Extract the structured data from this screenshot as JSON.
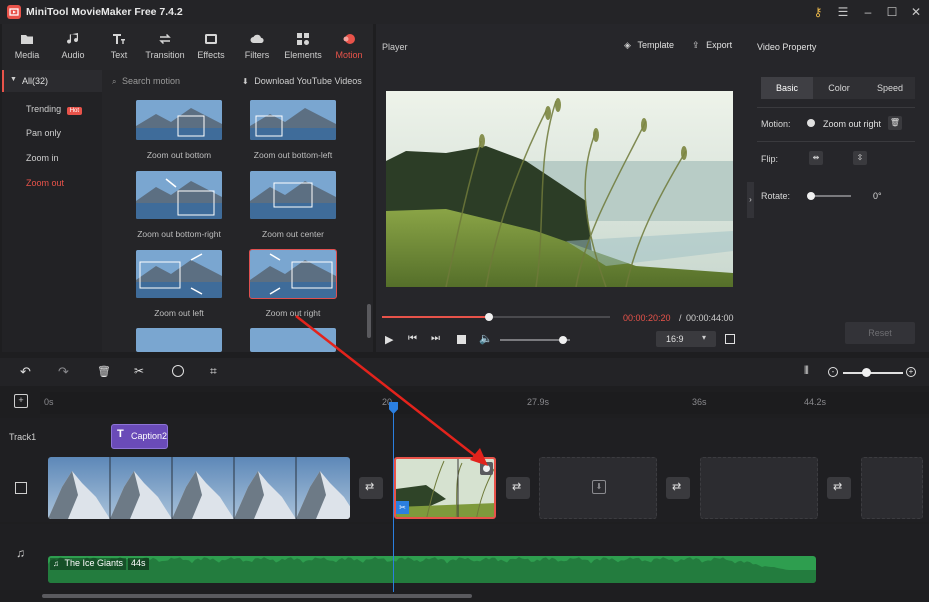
{
  "app": {
    "title": "MiniTool MovieMaker Free 7.4.2"
  },
  "toolbar": {
    "items": [
      {
        "label": "Media",
        "icon": "folder-icon"
      },
      {
        "label": "Audio",
        "icon": "music-note-icon"
      },
      {
        "label": "Text",
        "icon": "text-icon"
      },
      {
        "label": "Transition",
        "icon": "transition-icon"
      },
      {
        "label": "Effects",
        "icon": "effects-icon"
      },
      {
        "label": "Filters",
        "icon": "filters-icon"
      },
      {
        "label": "Elements",
        "icon": "elements-icon"
      },
      {
        "label": "Motion",
        "icon": "motion-icon"
      }
    ],
    "active": "Motion",
    "accent": "#e8534a"
  },
  "categories": {
    "all_label": "All(32)",
    "items": [
      {
        "label": "Trending",
        "badge": "Hot"
      },
      {
        "label": "Pan only"
      },
      {
        "label": "Zoom in"
      },
      {
        "label": "Zoom out",
        "active": true
      }
    ]
  },
  "motion": {
    "search_placeholder": "Search motion",
    "download_label": "Download YouTube Videos",
    "effects": [
      {
        "label": "Zoom out bottom"
      },
      {
        "label": "Zoom out bottom-left"
      },
      {
        "label": "Zoom out bottom-right"
      },
      {
        "label": "Zoom out center"
      },
      {
        "label": "Zoom out left"
      },
      {
        "label": "Zoom out right",
        "selected": true
      }
    ]
  },
  "player": {
    "title": "Player",
    "template_label": "Template",
    "export_label": "Export",
    "current_time": "00:00:20:20",
    "separator": "/",
    "total_time": "00:00:44:00",
    "progress": 0.47,
    "volume": 0.9,
    "aspect": "16:9"
  },
  "property": {
    "title": "Video Property",
    "tabs": [
      "Basic",
      "Color",
      "Speed"
    ],
    "active_tab": "Basic",
    "motion_label": "Motion:",
    "motion_value": "Zoom out right",
    "flip_label": "Flip:",
    "rotate_label": "Rotate:",
    "rotate_value": "0°",
    "reset_label": "Reset"
  },
  "timeline": {
    "ruler": [
      "0s",
      "20",
      "27.9s",
      "36s",
      "44.2s"
    ],
    "track_label": "Track1",
    "caption_label": "Caption2",
    "audio_label": "The Ice Giants",
    "audio_duration": "44s",
    "audio_color": "#2e9e4f"
  }
}
